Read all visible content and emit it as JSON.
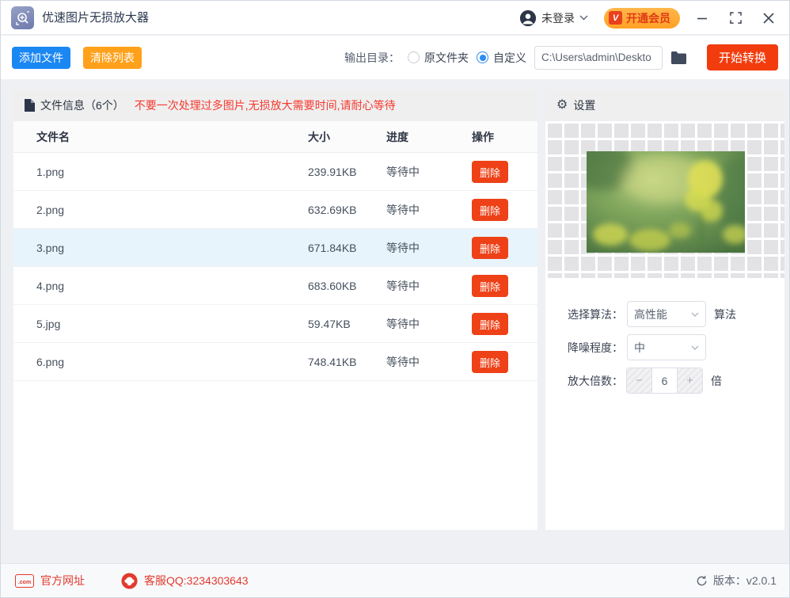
{
  "titlebar": {
    "app_title": "优速图片无损放大器",
    "login_text": "未登录",
    "vip_badge": "V",
    "vip_button": "开通会员"
  },
  "toolbar": {
    "add_files": "添加文件",
    "clear_list": "清除列表",
    "output_dir_label": "输出目录：",
    "radio_original": "原文件夹",
    "radio_custom": "自定义",
    "output_path": "C:\\Users\\admin\\Deskto",
    "start_button": "开始转换"
  },
  "file_panel": {
    "header_title": "文件信息（6个）",
    "warning": "不要一次处理过多图片,无损放大需要时间,请耐心等待",
    "columns": {
      "name": "文件名",
      "size": "大小",
      "progress": "进度",
      "action": "操作"
    },
    "delete_label": "删除",
    "rows": [
      {
        "name": "1.png",
        "size": "239.91KB",
        "status": "等待中"
      },
      {
        "name": "2.png",
        "size": "632.69KB",
        "status": "等待中"
      },
      {
        "name": "3.png",
        "size": "671.84KB",
        "status": "等待中"
      },
      {
        "name": "4.png",
        "size": "683.60KB",
        "status": "等待中"
      },
      {
        "name": "5.jpg",
        "size": "59.47KB",
        "status": "等待中"
      },
      {
        "name": "6.png",
        "size": "748.41KB",
        "status": "等待中"
      }
    ]
  },
  "settings_panel": {
    "header_title": "设置",
    "algorithm_label": "选择算法：",
    "algorithm_value": "高性能",
    "algorithm_suffix": "算法",
    "denoise_label": "降噪程度：",
    "denoise_value": "中",
    "scale_label": "放大倍数：",
    "scale_value": "6",
    "scale_minus": "−",
    "scale_plus": "+",
    "scale_suffix": "倍"
  },
  "footer": {
    "com_icon_text": ".com",
    "website_label": "官方网址",
    "qq_label": "客服QQ:3234303643",
    "version_label": "版本：v2.0.1"
  },
  "icons": {
    "gear": "⚙"
  },
  "colors": {
    "accent_blue": "#1b87f2",
    "accent_orange": "#ffa11b",
    "start_red": "#f23c0e",
    "delete_red": "#ee4117",
    "warning_red": "#f5392e",
    "footer_red": "#e23a2e",
    "vip_pill": "#ffa125",
    "row_highlight": "#e7f4fc",
    "radio_blue": "#2d8cf0"
  }
}
